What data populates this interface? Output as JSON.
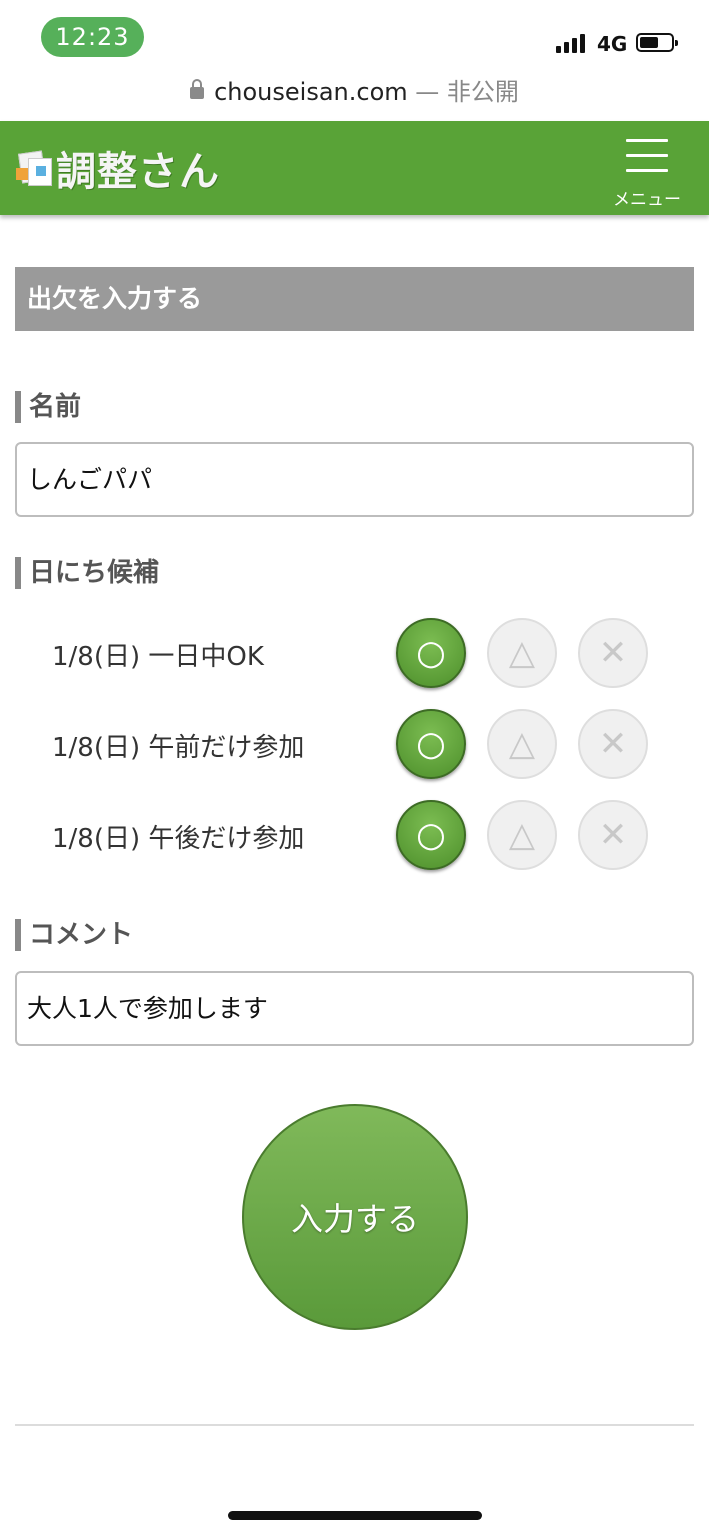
{
  "status_bar": {
    "time": "12:23",
    "network": "4G"
  },
  "browser": {
    "domain": "chouseisan.com",
    "privacy": "— 非公開"
  },
  "header": {
    "logo_text": "調整さん",
    "menu_label": "メニュー",
    "brand_color": "#59a337"
  },
  "form": {
    "section_title": "出欠を入力する",
    "name_label": "名前",
    "name_value": "しんごパパ",
    "dates_label": "日にち候補",
    "dates": [
      {
        "label": "1/8(日) 一日中OK",
        "selected": "ok"
      },
      {
        "label": "1/8(日) 午前だけ参加",
        "selected": "ok"
      },
      {
        "label": "1/8(日) 午後だけ参加",
        "selected": "ok"
      }
    ],
    "choice_glyphs": {
      "ok": "○",
      "maybe": "△",
      "ng": "✕"
    },
    "comment_label": "コメント",
    "comment_value": "大人1人で参加します",
    "submit_label": "入力する"
  }
}
